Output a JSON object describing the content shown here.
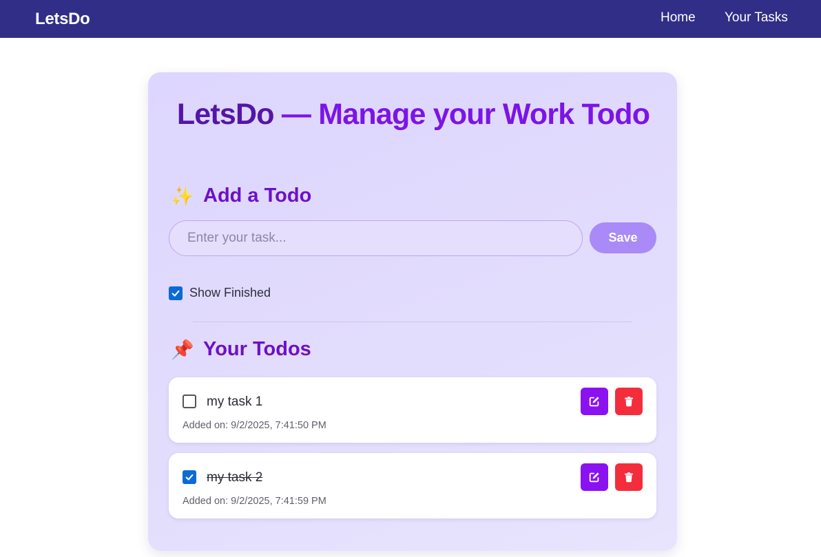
{
  "navbar": {
    "brand": "LetsDo",
    "links": [
      "Home",
      "Your Tasks"
    ]
  },
  "card": {
    "title_brand": "LetsDo",
    "title_rest": " — Manage your Work Todo",
    "add_section": {
      "emoji": "✨",
      "heading": "Add a Todo"
    },
    "input": {
      "placeholder": "Enter your task...",
      "value": ""
    },
    "save_label": "Save",
    "show_finished": {
      "label": "Show Finished",
      "checked": true
    },
    "todos_section": {
      "emoji": "📌",
      "heading": "Your Todos"
    },
    "todos": [
      {
        "text": "my task 1",
        "added": "Added on: 9/2/2025, 7:41:50 PM",
        "done": false
      },
      {
        "text": "my task 2",
        "added": "Added on: 9/2/2025, 7:41:59 PM",
        "done": true
      }
    ]
  },
  "colors": {
    "navbar": "#312e88",
    "accent": "#7c14e6",
    "edit": "#8a12f0",
    "delete": "#f42d3c",
    "checkbox": "#0b6bd3"
  },
  "icons": [
    "edit-icon",
    "trash-icon",
    "checkmark-icon",
    "sparkles-icon",
    "pushpin-icon"
  ]
}
